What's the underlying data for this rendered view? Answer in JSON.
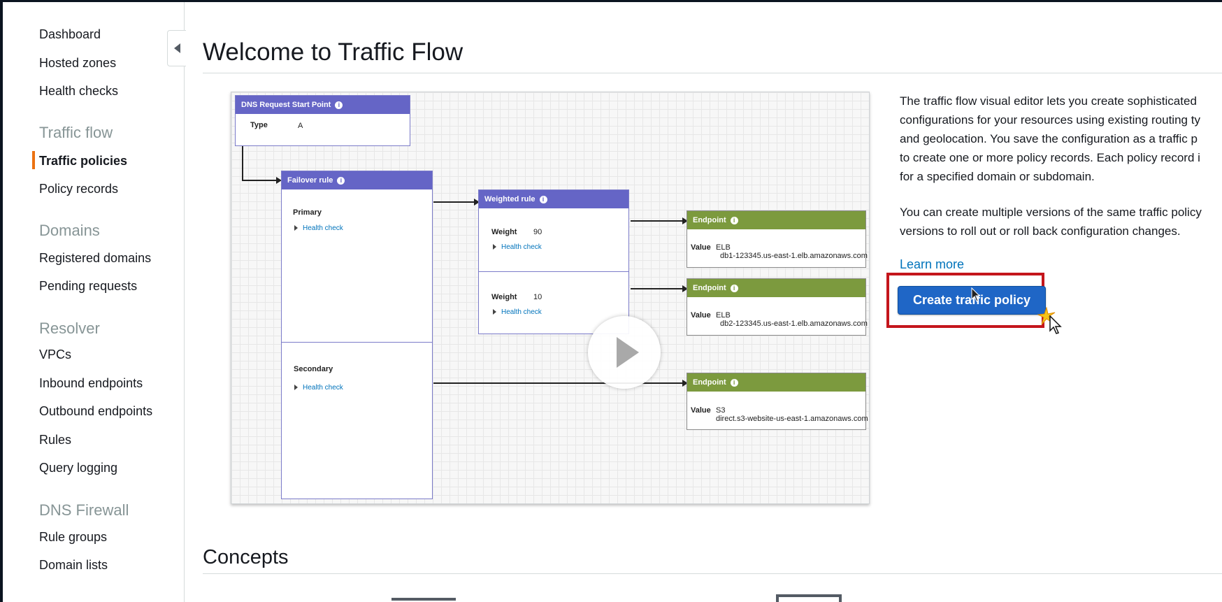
{
  "sidebar": {
    "items_top": [
      "Dashboard",
      "Hosted zones",
      "Health checks"
    ],
    "sections": [
      {
        "title": "Traffic flow",
        "items": [
          "Traffic policies",
          "Policy records"
        ],
        "active": "Traffic policies"
      },
      {
        "title": "Domains",
        "items": [
          "Registered domains",
          "Pending requests"
        ]
      },
      {
        "title": "Resolver",
        "items": [
          "VPCs",
          "Inbound endpoints",
          "Outbound endpoints",
          "Rules",
          "Query logging"
        ]
      },
      {
        "title": "DNS Firewall",
        "items": [
          "Rule groups",
          "Domain lists"
        ]
      }
    ],
    "collapse_icon": "caret-left-icon"
  },
  "main": {
    "title": "Welcome to Traffic Flow",
    "concepts_title": "Concepts"
  },
  "diagram": {
    "start_node": {
      "title": "DNS Request Start Point",
      "type_label": "Type",
      "type_value": "A"
    },
    "failover_rule": {
      "title": "Failover rule",
      "primary_label": "Primary",
      "secondary_label": "Secondary",
      "health_check": "Health check"
    },
    "weighted_rule": {
      "title": "Weighted rule",
      "weight_label": "Weight",
      "weight_1": "90",
      "weight_2": "10",
      "health_check": "Health check"
    },
    "endpoints": [
      {
        "title": "Endpoint",
        "value_label": "Value",
        "type": "ELB",
        "address": "db1-123345.us-east-1.elb.amazonaws.com"
      },
      {
        "title": "Endpoint",
        "value_label": "Value",
        "type": "ELB",
        "address": "db2-123345.us-east-1.elb.amazonaws.com"
      },
      {
        "title": "Endpoint",
        "value_label": "Value",
        "type": "S3",
        "address": "direct.s3-website-us-east-1.amazonaws.com"
      }
    ],
    "info_glyph": "i",
    "play_icon": "play-icon"
  },
  "description": {
    "lines_1": [
      "The traffic flow visual editor lets you create sophisticated",
      "configurations for your resources using existing routing ty",
      "and geolocation. You save the configuration as a traffic p",
      "to create one or more policy records. Each policy record i",
      "for a specified domain or subdomain."
    ],
    "lines_2": [
      "You can create multiple versions of the same traffic policy",
      "versions to roll out or roll back configuration changes."
    ],
    "learn_more": "Learn more",
    "create_button": "Create traffic policy"
  },
  "colors": {
    "accent": "#ec7211",
    "rule_header": "#6565c6",
    "endpoint_header": "#7c9a3e",
    "primary_button": "#1f66c6",
    "highlight": "#c4161c",
    "link": "#0073bb"
  }
}
